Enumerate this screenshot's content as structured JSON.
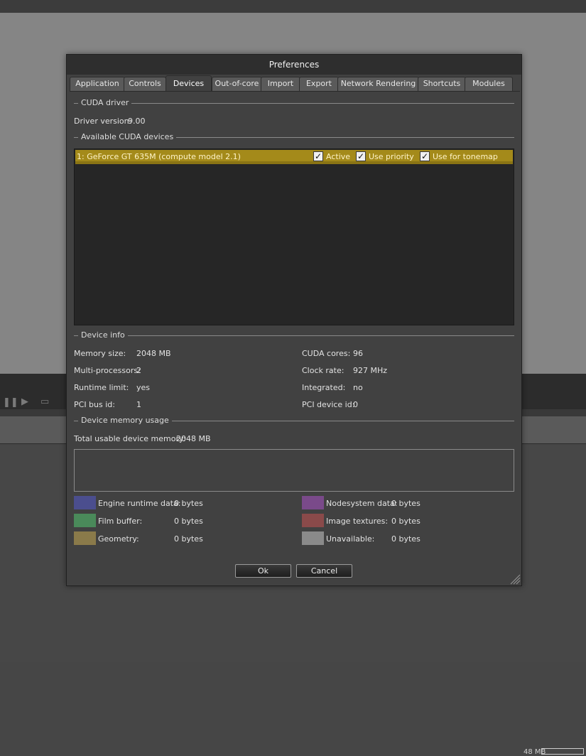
{
  "dialog": {
    "title": "Preferences"
  },
  "tabs": [
    "Application",
    "Controls",
    "Devices",
    "Out-of-core",
    "Import",
    "Export",
    "Network Rendering",
    "Shortcuts",
    "Modules"
  ],
  "active_tab": "Devices",
  "cuda_driver": {
    "section_label": "CUDA driver",
    "version_label": "Driver version:",
    "version_value": "9.00"
  },
  "devices": {
    "section_label": "Available CUDA devices",
    "items": [
      {
        "name": "1: GeForce GT 635M (compute model 2.1)",
        "active": "Active",
        "use_priority": "Use priority",
        "use_tonemap": "Use for tonemap"
      }
    ]
  },
  "device_info": {
    "section_label": "Device info",
    "memory_size_label": "Memory size:",
    "memory_size": "2048 MB",
    "multiprocessors_label": "Multi-processors:",
    "multiprocessors": "2",
    "runtime_limit_label": "Runtime limit:",
    "runtime_limit": "yes",
    "pci_bus_label": "PCI bus id:",
    "pci_bus": "1",
    "cuda_cores_label": "CUDA cores:",
    "cuda_cores": "96",
    "clock_rate_label": "Clock rate:",
    "clock_rate": "927 MHz",
    "integrated_label": "Integrated:",
    "integrated": "no",
    "pci_device_label": "PCI device id:",
    "pci_device": "0"
  },
  "memory_usage": {
    "section_label": "Device memory usage",
    "total_label": "Total usable device memory:",
    "total_value": "2048 MB",
    "legend": [
      {
        "label": "Engine runtime data:",
        "value": "0 bytes",
        "color": "#4b4e8e"
      },
      {
        "label": "Film buffer:",
        "value": "0 bytes",
        "color": "#4a8a5a"
      },
      {
        "label": "Geometry:",
        "value": "0 bytes",
        "color": "#8a7a4a"
      },
      {
        "label": "Nodesystem data:",
        "value": "0 bytes",
        "color": "#7a4a8a"
      },
      {
        "label": "Image textures:",
        "value": "0 bytes",
        "color": "#8a4a4a"
      },
      {
        "label": "Unavailable:",
        "value": "0 bytes",
        "color": "#8a8a8a"
      }
    ]
  },
  "buttons": {
    "ok": "Ok",
    "cancel": "Cancel"
  },
  "background_app": {
    "memory_readout": "48 MB"
  },
  "colors": {
    "selection": "#a48a1a",
    "dialog_bg": "#414141",
    "title_bg": "#2e2e2e"
  }
}
